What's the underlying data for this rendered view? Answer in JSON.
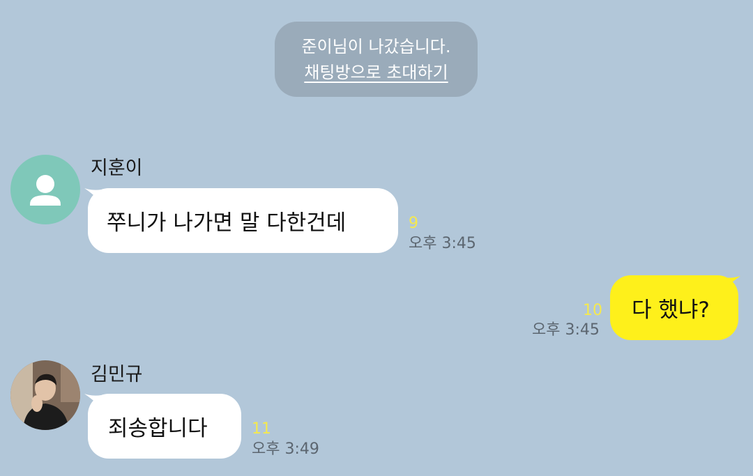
{
  "notice": {
    "left_text": "준이님이 나갔습니다.",
    "invite_link": "채팅방으로 초대하기"
  },
  "messages": [
    {
      "sender": "지훈이",
      "text": "쭈니가 나가면 말 다한건데",
      "unread": "9",
      "time": "오후 3:45",
      "avatar_icon": "default-profile-icon"
    },
    {
      "text": "다 했냐?",
      "unread": "10",
      "time": "오후 3:45"
    },
    {
      "sender": "김민규",
      "text": "죄송합니다",
      "unread": "11",
      "time": "오후 3:49",
      "avatar_icon": "profile-photo-icon"
    }
  ],
  "colors": {
    "background": "#b2c7d9",
    "incoming_bubble": "#ffffff",
    "outgoing_bubble": "#fef01b",
    "unread_count": "#f5e94e",
    "notice_bg": "#9aabba",
    "default_avatar": "#7fc8b9"
  }
}
